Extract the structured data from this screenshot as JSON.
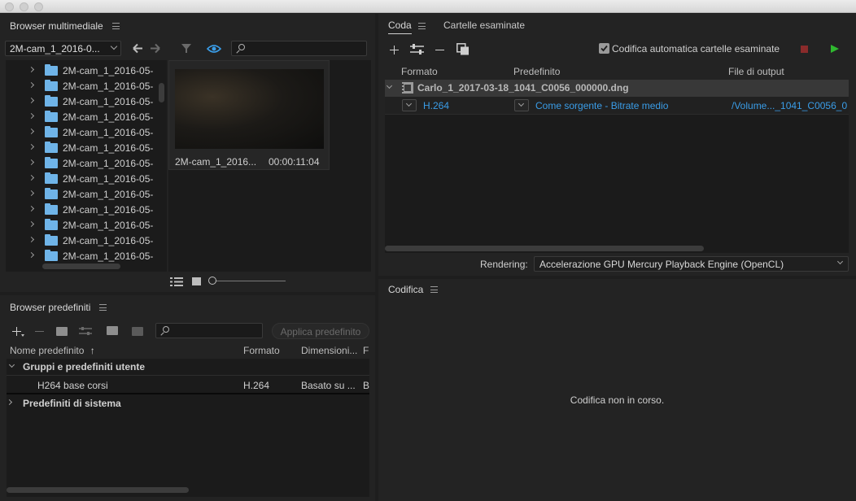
{
  "colors": {
    "accent": "#3a9de8",
    "folder": "#6fb4e8",
    "stop": "#8a2b2b",
    "play": "#2fb82f",
    "panel_bg": "#232323"
  },
  "media_browser": {
    "title": "Browser multimediale",
    "location": "2M-cam_1_2016-0...",
    "icons": [
      "back-arrow-icon",
      "forward-arrow-icon",
      "filter-icon",
      "eye-icon",
      "search-icon"
    ],
    "tree_items": [
      "2M-cam_1_2016-05-",
      "2M-cam_1_2016-05-",
      "2M-cam_1_2016-05-",
      "2M-cam_1_2016-05-",
      "2M-cam_1_2016-05-",
      "2M-cam_1_2016-05-",
      "2M-cam_1_2016-05-",
      "2M-cam_1_2016-05-",
      "2M-cam_1_2016-05-",
      "2M-cam_1_2016-05-",
      "2M-cam_1_2016-05-",
      "2M-cam_1_2016-05-",
      "2M-cam_1_2016-05-"
    ],
    "thumbnail": {
      "name": "2M-cam_1_2016...",
      "duration": "00:00:11:04"
    }
  },
  "preset_browser": {
    "title": "Browser predefiniti",
    "apply_button": "Applica predefinito",
    "columns": [
      "Nome predefinito",
      "Formato",
      "Dimensioni...",
      "F"
    ],
    "sort_icon": "sort-ascending-icon",
    "groups": [
      {
        "name": "Gruppi e predefiniti utente",
        "expanded": true,
        "items": [
          {
            "name": "H264 base corsi",
            "format": "H.264",
            "size": "Basato su ...",
            "extra": "B"
          }
        ]
      },
      {
        "name": "Predefiniti di sistema",
        "expanded": false,
        "items": []
      }
    ]
  },
  "queue": {
    "tabs": [
      "Coda",
      "Cartelle esaminate"
    ],
    "auto_encode_label": "Codifica automatica cartelle esaminate",
    "auto_encode_checked": true,
    "columns": [
      "Formato",
      "Predefinito",
      "File di output"
    ],
    "items": [
      {
        "source": "Carlo_1_2017-03-18_1041_C0056_000000.dng",
        "format": "H.264",
        "preset": "Come sorgente - Bitrate medio",
        "output": "/Volume..._1041_C0056_0"
      }
    ],
    "rendering_label": "Rendering:",
    "rendering_value": "Accelerazione GPU Mercury Playback Engine (OpenCL)"
  },
  "encoding": {
    "title": "Codifica",
    "status": "Codifica non in corso."
  }
}
